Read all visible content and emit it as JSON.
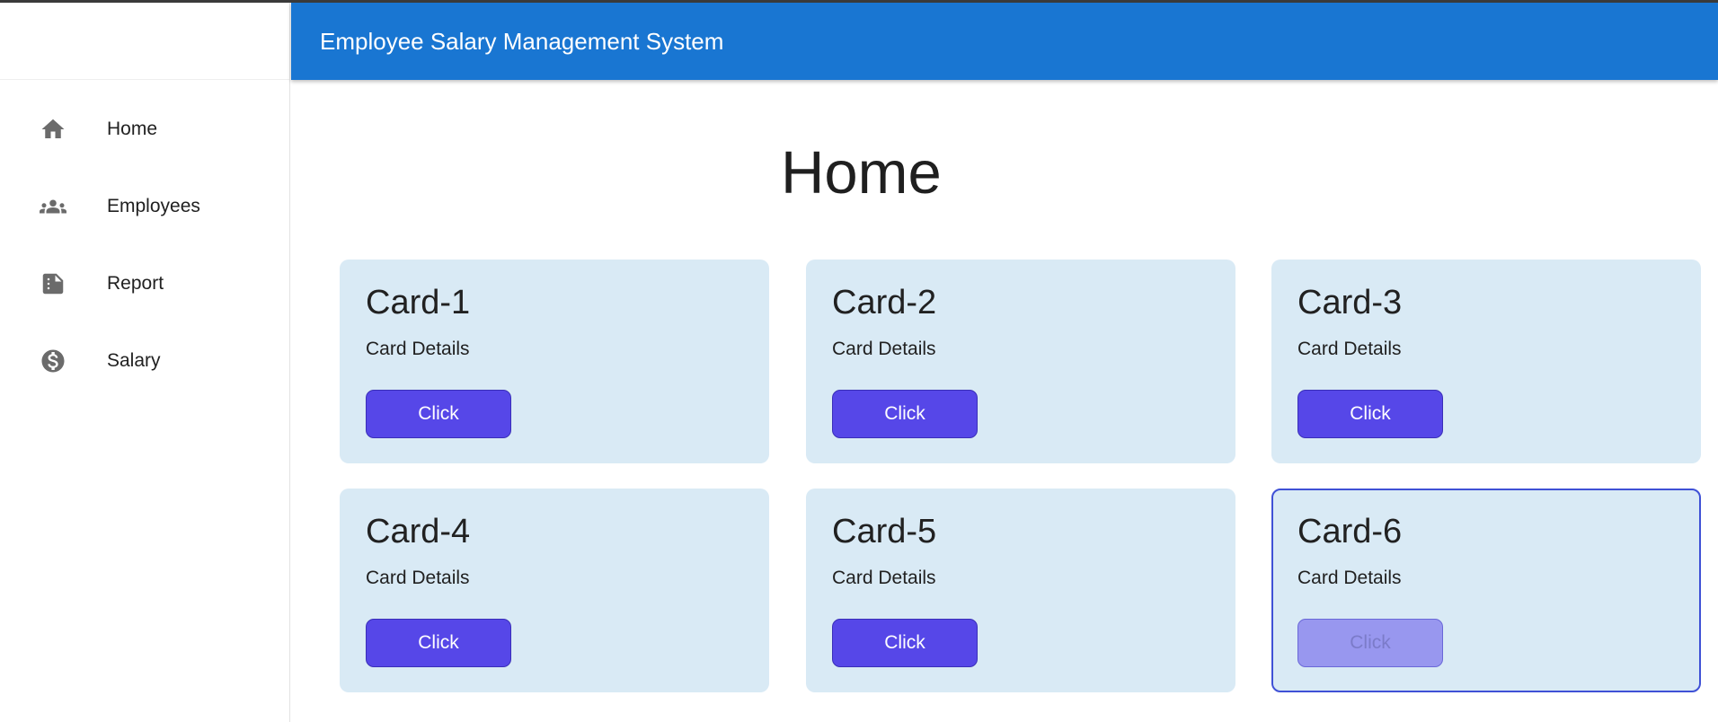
{
  "app": {
    "title": "Employee Salary Management System"
  },
  "sidebar": {
    "items": [
      {
        "label": "Home",
        "icon": "home-icon"
      },
      {
        "label": "Employees",
        "icon": "people-icon"
      },
      {
        "label": "Report",
        "icon": "report-icon"
      },
      {
        "label": "Salary",
        "icon": "dollar-icon"
      }
    ]
  },
  "main": {
    "page_title": "Home",
    "cards": [
      {
        "title": "Card-1",
        "details": "Card Details",
        "button": "Click",
        "disabled": false
      },
      {
        "title": "Card-2",
        "details": "Card Details",
        "button": "Click",
        "disabled": false
      },
      {
        "title": "Card-3",
        "details": "Card Details",
        "button": "Click",
        "disabled": false
      },
      {
        "title": "Card-4",
        "details": "Card Details",
        "button": "Click",
        "disabled": false
      },
      {
        "title": "Card-5",
        "details": "Card Details",
        "button": "Click",
        "disabled": false
      },
      {
        "title": "Card-6",
        "details": "Card Details",
        "button": "Click",
        "disabled": true
      }
    ]
  },
  "colors": {
    "appbar": "#1976d2",
    "card_background": "#d9eaf5",
    "button": "#5647e8",
    "button_disabled": "#9897ef",
    "focus_border": "#3f51d6"
  }
}
